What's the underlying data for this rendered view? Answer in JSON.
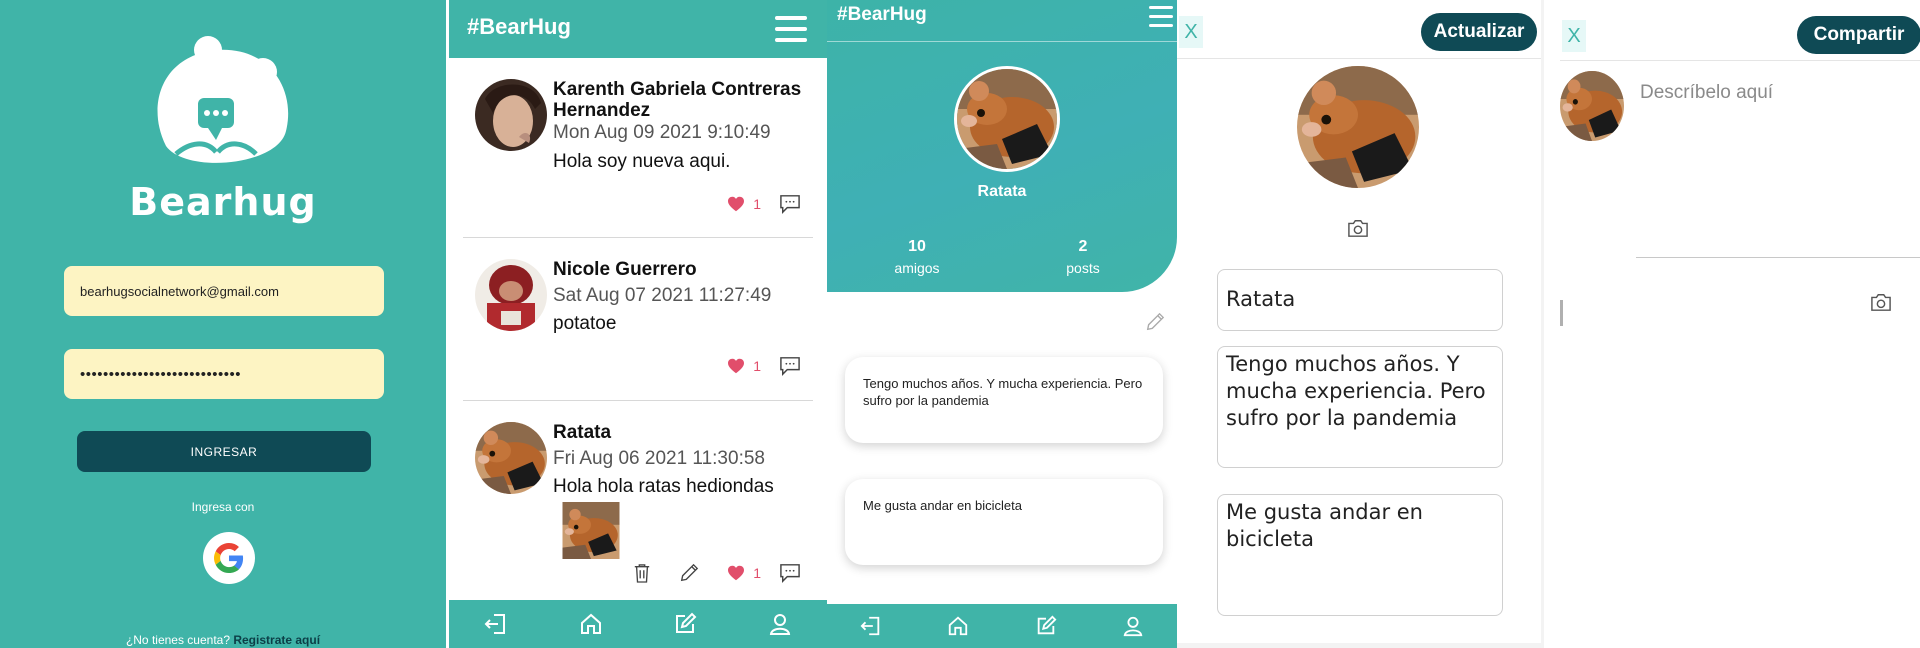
{
  "colors": {
    "teal": "#40b4a8",
    "dark_teal": "#0f4a55",
    "heart": "#e14e6b",
    "field_bg": "#fdf4c3"
  },
  "login": {
    "brand": "Bearhug",
    "email_value": "bearhugsocialnetwork@gmail.com",
    "password_mask": "••••••••••••••••••••••••••••",
    "submit_label": "INGRESAR",
    "alt_login_label": "Ingresa con",
    "google_icon": "google-icon",
    "signup_prompt": "¿No tienes cuenta?",
    "signup_link": "Registrate aquí"
  },
  "feed": {
    "title": "#BearHug",
    "posts": [
      {
        "author": "Karenth Gabriela Contreras Hernandez",
        "date": "Mon Aug 09 2021 9:10:49",
        "text": "Hola soy nueva aqui.",
        "likes": "1"
      },
      {
        "author": "Nicole Guerrero",
        "date": "Sat Aug 07 2021 11:27:49",
        "text": "potatoe",
        "likes": "1"
      },
      {
        "author": "Ratata",
        "date": "Fri Aug 06 2021 11:30:58",
        "text": "Hola hola ratas hediondas",
        "likes": "1"
      }
    ],
    "nav_icons": [
      "logout-icon",
      "home-icon",
      "edit-icon",
      "profile-icon"
    ]
  },
  "profile": {
    "title": "#BearHug",
    "name": "Ratata",
    "friends_count": "10",
    "friends_label": "amigos",
    "posts_count": "2",
    "posts_label": "posts",
    "bio": "Tengo muchos años. Y mucha experiencia. Pero sufro por la pandemia",
    "hobby": "Me gusta andar en bicicleta"
  },
  "edit_profile": {
    "close_label": "X",
    "update_label": "Actualizar",
    "name_value": "Ratata",
    "bio_value": "Tengo muchos años. Y mucha experiencia. Pero sufro por la pandemia",
    "hobby_value": "Me gusta andar en bicicleta"
  },
  "new_post": {
    "close_label": "X",
    "share_label": "Compartir",
    "placeholder": "Descríbelo aquí"
  }
}
